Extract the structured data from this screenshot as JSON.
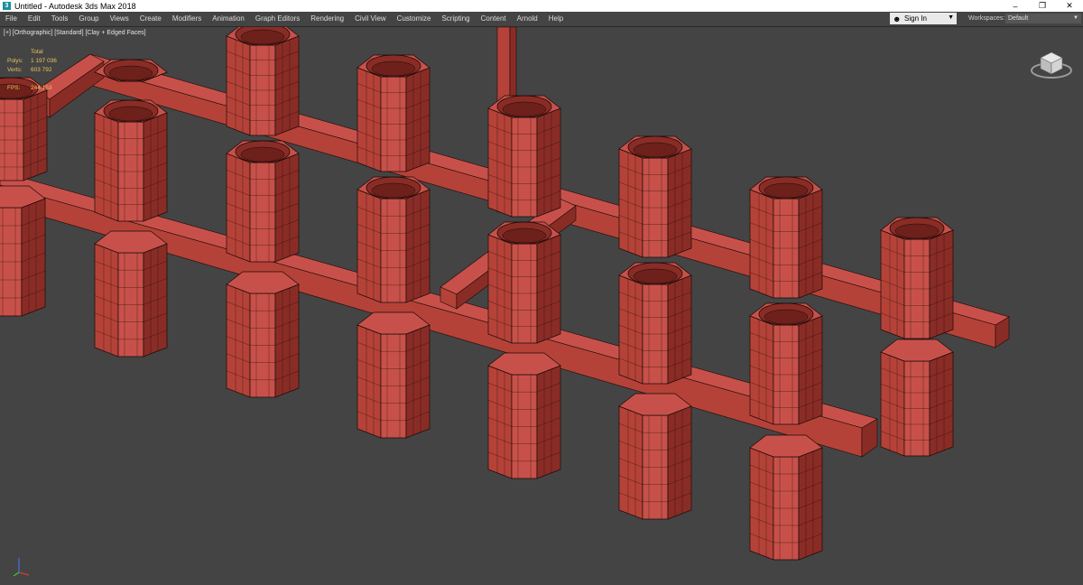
{
  "titlebar": {
    "app_icon_glyph": "3",
    "title": "Untitled - Autodesk 3ds Max 2018",
    "minimize": "–",
    "restore": "❐",
    "close": "✕"
  },
  "menu": {
    "items": [
      "File",
      "Edit",
      "Tools",
      "Group",
      "Views",
      "Create",
      "Modifiers",
      "Animation",
      "Graph Editors",
      "Rendering",
      "Civil View",
      "Customize",
      "Scripting",
      "Content",
      "Arnold",
      "Help"
    ],
    "sign_in": "Sign In",
    "workspaces_label": "Workspaces:",
    "workspace_value": "Default"
  },
  "viewport": {
    "label": "[+] [Orthographic] [Standard] [Clay + Edged Faces]",
    "stats": {
      "header": "Total",
      "polys_label": "Polys:",
      "polys_value": "1 197 036",
      "verts_label": "Verts:",
      "verts_value": "603 792",
      "fps_label": "FPS:",
      "fps_value": "244,153"
    }
  },
  "colors": {
    "clay": "#b54238",
    "clay_light": "#c7514a",
    "clay_dark": "#8a2c26",
    "wire": "#1a0a08",
    "viewport_bg": "#444444",
    "stats_text": "#e9c35a"
  },
  "icons": {
    "app": "3ds-max-icon",
    "user": "user-icon",
    "viewcube": "viewcube-icon",
    "axis": "axis-tripod-icon"
  }
}
